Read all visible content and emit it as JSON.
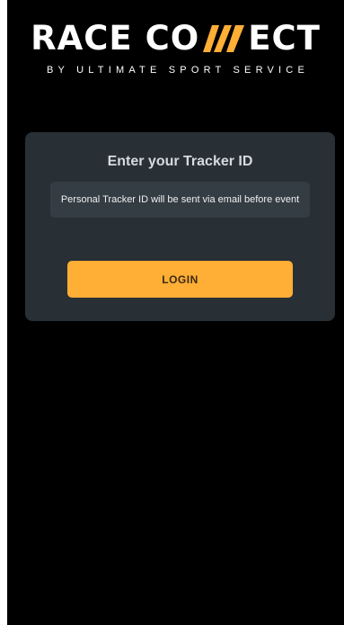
{
  "logo": {
    "part1": "RACE CO",
    "part2": "ECT",
    "tagline": "BY ULTIMATE SPORT SERVICE",
    "accent_color": "#ffae36",
    "n_icon": "lightning-n-logo-icon"
  },
  "login_card": {
    "title": "Enter your Tracker ID",
    "tracker_input": {
      "value": "",
      "placeholder": "Personal Tracker ID will be sent via email before event"
    },
    "login_label": "LOGIN"
  },
  "colors": {
    "background": "#000000",
    "card": "#282f35",
    "input": "#353d44",
    "button": "#ffae36"
  }
}
